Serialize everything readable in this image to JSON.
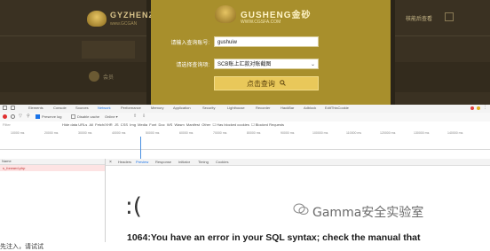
{
  "site": {
    "left_logo_text": "GYZHENZ",
    "left_logo_sub": "www.GCGAN",
    "right_nav_text": "核能后查看",
    "modal_logo_text": "GUSHENG金砂",
    "modal_logo_sub": "WWW.CGSFA.COM",
    "form": {
      "name_label": "请输入查询账号:",
      "name_value": "gushuiw",
      "type_label": "请选择查询项:",
      "type_value": "SCB账上汇款对账截图",
      "submit_label": "点击查询"
    }
  },
  "devtools": {
    "tabs": [
      "Elements",
      "Console",
      "Sources",
      "Network",
      "Performance",
      "Memory",
      "Application",
      "Security",
      "Lighthouse",
      "Recorder",
      "HackBar",
      "Adblock",
      "EditThisCookie"
    ],
    "active_tab": "Network",
    "filter_text": "Filter",
    "ticks": [
      "10000 ms",
      "20000 ms",
      "30000 ms",
      "40000 ms",
      "50000 ms",
      "60000 ms",
      "70000 ms",
      "80000 ms",
      "90000 ms",
      "100000 ms",
      "110000 ms",
      "120000 ms",
      "130000 ms",
      "140000 ms"
    ],
    "req_header": "Name",
    "request_name": "s_forward.php",
    "detail_tabs": [
      "Headers",
      "Preview",
      "Response",
      "Initiator",
      "Timing",
      "Cookies"
    ],
    "active_detail_tab": "Preview",
    "sad_face": ":(",
    "watermark": "Gamma安全实验室",
    "error_message": "1064:You have an error in your SQL syntax; check the manual that"
  },
  "caption": "先注入，请试试"
}
